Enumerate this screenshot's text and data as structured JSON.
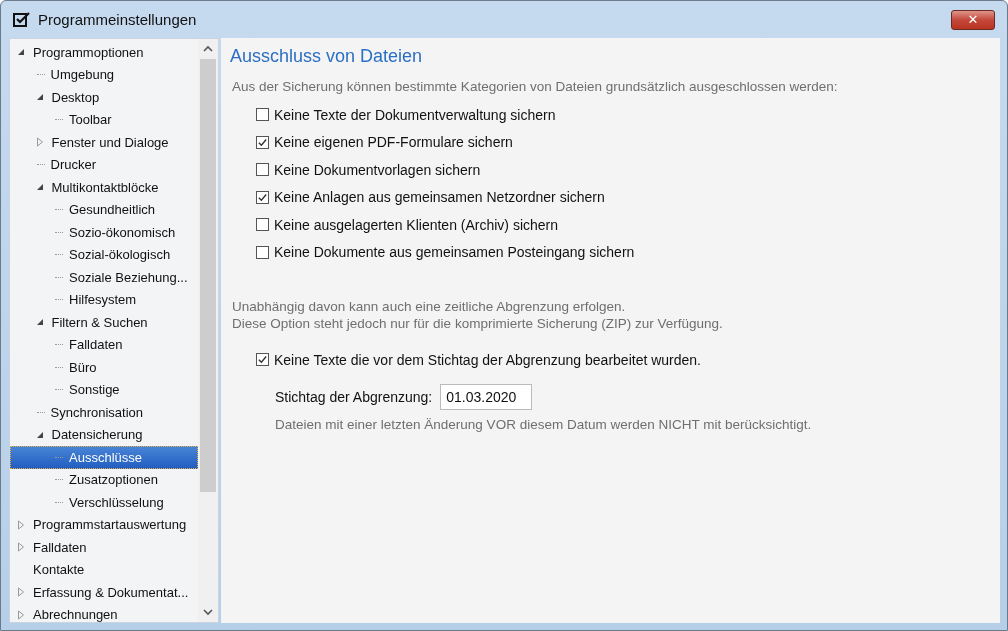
{
  "window": {
    "title": "Programmeinstellungen",
    "close_label": "✕"
  },
  "tree": [
    {
      "label": "Programmoptionen",
      "expanded": true,
      "selected": false,
      "children": [
        {
          "label": "Umgebung",
          "selected": false
        },
        {
          "label": "Desktop",
          "expanded": true,
          "selected": false,
          "children": [
            {
              "label": "Toolbar",
              "selected": false
            }
          ]
        },
        {
          "label": "Fenster und Dialoge",
          "expanded": false,
          "selected": false
        },
        {
          "label": "Drucker",
          "selected": false
        },
        {
          "label": "Multikontaktblöcke",
          "expanded": true,
          "selected": false,
          "children": [
            {
              "label": "Gesundheitlich",
              "selected": false
            },
            {
              "label": "Sozio-ökonomisch",
              "selected": false
            },
            {
              "label": "Sozial-ökologisch",
              "selected": false
            },
            {
              "label": "Soziale Beziehung...",
              "selected": false
            },
            {
              "label": "Hilfesystem",
              "selected": false
            }
          ]
        },
        {
          "label": "Filtern & Suchen",
          "expanded": true,
          "selected": false,
          "children": [
            {
              "label": "Falldaten",
              "selected": false
            },
            {
              "label": "Büro",
              "selected": false
            },
            {
              "label": "Sonstige",
              "selected": false
            }
          ]
        },
        {
          "label": "Synchronisation",
          "selected": false
        },
        {
          "label": "Datensicherung",
          "expanded": true,
          "selected": false,
          "children": [
            {
              "label": "Ausschlüsse",
              "selected": true
            },
            {
              "label": "Zusatzoptionen",
              "selected": false
            },
            {
              "label": "Verschlüsselung",
              "selected": false
            }
          ]
        }
      ]
    },
    {
      "label": "Programmstartauswertung",
      "expanded": false,
      "selected": false
    },
    {
      "label": "Falldaten",
      "expanded": false,
      "selected": false
    },
    {
      "label": "Kontakte",
      "selected": false
    },
    {
      "label": "Erfassung & Dokumentat...",
      "expanded": false,
      "selected": false
    },
    {
      "label": "Abrechnungen",
      "expanded": false,
      "selected": false
    }
  ],
  "content": {
    "heading": "Ausschluss von Dateien",
    "intro": "Aus der Sicherung können bestimmte Kategorien von Dateien grundsätzlich ausgeschlossen werden:",
    "options": [
      {
        "label": "Keine Texte der Dokumentverwaltung sichern",
        "checked": false
      },
      {
        "label": "Keine eigenen PDF-Formulare sichern",
        "checked": true
      },
      {
        "label": "Keine Dokumentvorlagen sichern",
        "checked": false
      },
      {
        "label": "Keine Anlagen aus gemeinsamen Netzordner sichern",
        "checked": true
      },
      {
        "label": "Keine ausgelagerten Klienten (Archiv) sichern",
        "checked": false
      },
      {
        "label": "Keine Dokumente aus gemeinsamen Posteingang sichern",
        "checked": false
      }
    ],
    "note_lines": [
      "Unabhängig davon kann auch eine zeitliche Abgrenzung erfolgen.",
      "Diese Option steht jedoch nur für die komprimierte Sicherung (ZIP) zur Verfügung."
    ],
    "date_option": {
      "label": "Keine Texte die vor dem Stichtag der Abgrenzung bearbeitet wurden.",
      "checked": true
    },
    "date_field": {
      "label": "Stichtag der Abgrenzung:",
      "value": "01.03.2020"
    },
    "date_hint": "Dateien mit einer letzten Änderung VOR diesem Datum werden NICHT mit berücksichtigt."
  }
}
